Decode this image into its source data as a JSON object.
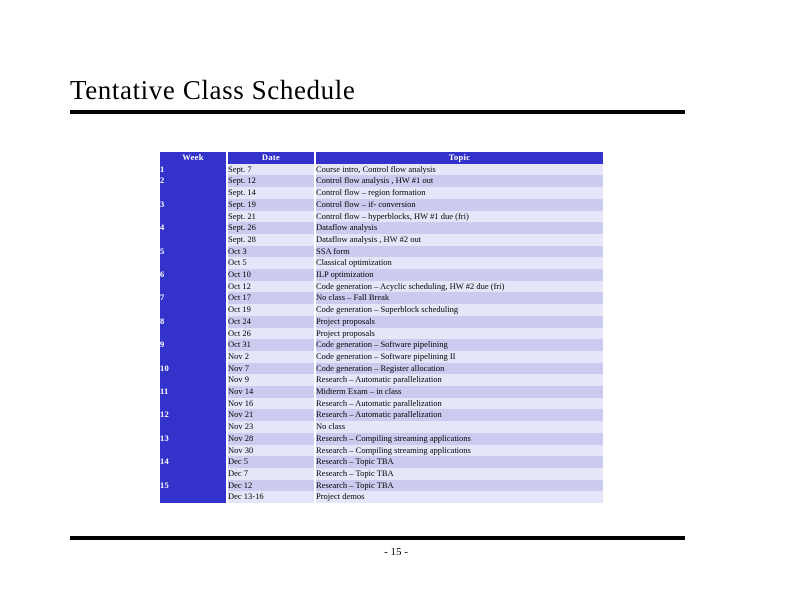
{
  "slide": {
    "title": "Tentative Class Schedule",
    "page_number": "- 15 -"
  },
  "theme": {
    "header_blue": "#3333CC",
    "row_shade_dark": "#CBCBEF",
    "row_shade_light": "#E6E6FA",
    "rule_color": "#000000",
    "header_text": "#FFFFFF"
  },
  "table": {
    "columns": [
      {
        "key": "week",
        "label": "Week"
      },
      {
        "key": "date",
        "label": "Date"
      },
      {
        "key": "topic",
        "label": "Topic"
      }
    ],
    "rows": [
      {
        "week": "1",
        "date": "Sept. 7",
        "topic": "Course intro, Control flow analysis"
      },
      {
        "week": "2",
        "date": "Sept. 12",
        "topic": "Control flow analysis , HW #1 out"
      },
      {
        "week": "",
        "date": "Sept. 14",
        "topic": "Control flow – region formation"
      },
      {
        "week": "3",
        "date": "Sept. 19",
        "topic": "Control flow – if- conversion"
      },
      {
        "week": "",
        "date": "Sept. 21",
        "topic": "Control flow – hyperblocks, HW #1 due (fri)"
      },
      {
        "week": "4",
        "date": "Sept. 26",
        "topic": "Dataflow analysis"
      },
      {
        "week": "",
        "date": "Sept. 28",
        "topic": "Dataflow analysis , HW #2 out"
      },
      {
        "week": "5",
        "date": "Oct 3",
        "topic": "SSA form"
      },
      {
        "week": "",
        "date": "Oct 5",
        "topic": "Classical optimization"
      },
      {
        "week": "6",
        "date": "Oct 10",
        "topic": "ILP optimization"
      },
      {
        "week": "",
        "date": "Oct 12",
        "topic": "Code generation – Acyclic scheduling, HW #2 due (fri)"
      },
      {
        "week": "7",
        "date": "Oct 17",
        "topic": "No class – Fall Break"
      },
      {
        "week": "",
        "date": "Oct 19",
        "topic": "Code generation – Superblock scheduling"
      },
      {
        "week": "8",
        "date": "Oct 24",
        "topic": "Project proposals"
      },
      {
        "week": "",
        "date": "Oct 26",
        "topic": "Project proposals"
      },
      {
        "week": "9",
        "date": "Oct 31",
        "topic": "Code generation – Software pipelining"
      },
      {
        "week": "",
        "date": "Nov 2",
        "topic": "Code generation – Software pipelining II"
      },
      {
        "week": "10",
        "date": "Nov 7",
        "topic": "Code generation – Register allocation"
      },
      {
        "week": "",
        "date": "Nov 9",
        "topic": "Research – Automatic parallelization"
      },
      {
        "week": "11",
        "date": "Nov 14",
        "topic": "Midterm Exam – in class"
      },
      {
        "week": "",
        "date": "Nov 16",
        "topic": "Research – Automatic parallelization"
      },
      {
        "week": "12",
        "date": "Nov 21",
        "topic": "Research – Automatic parallelization"
      },
      {
        "week": "",
        "date": "Nov 23",
        "topic": "No class"
      },
      {
        "week": "13",
        "date": "Nov 28",
        "topic": "Research – Compiling streaming applications"
      },
      {
        "week": "",
        "date": "Nov 30",
        "topic": "Research – Compiling streaming applications"
      },
      {
        "week": "14",
        "date": "Dec 5",
        "topic": "Research – Topic  TBA"
      },
      {
        "week": "",
        "date": "Dec 7",
        "topic": "Research – Topic  TBA"
      },
      {
        "week": "15",
        "date": "Dec 12",
        "topic": "Research – Topic  TBA"
      },
      {
        "week": "",
        "date": "Dec 13-16",
        "topic": "Project demos"
      }
    ]
  }
}
